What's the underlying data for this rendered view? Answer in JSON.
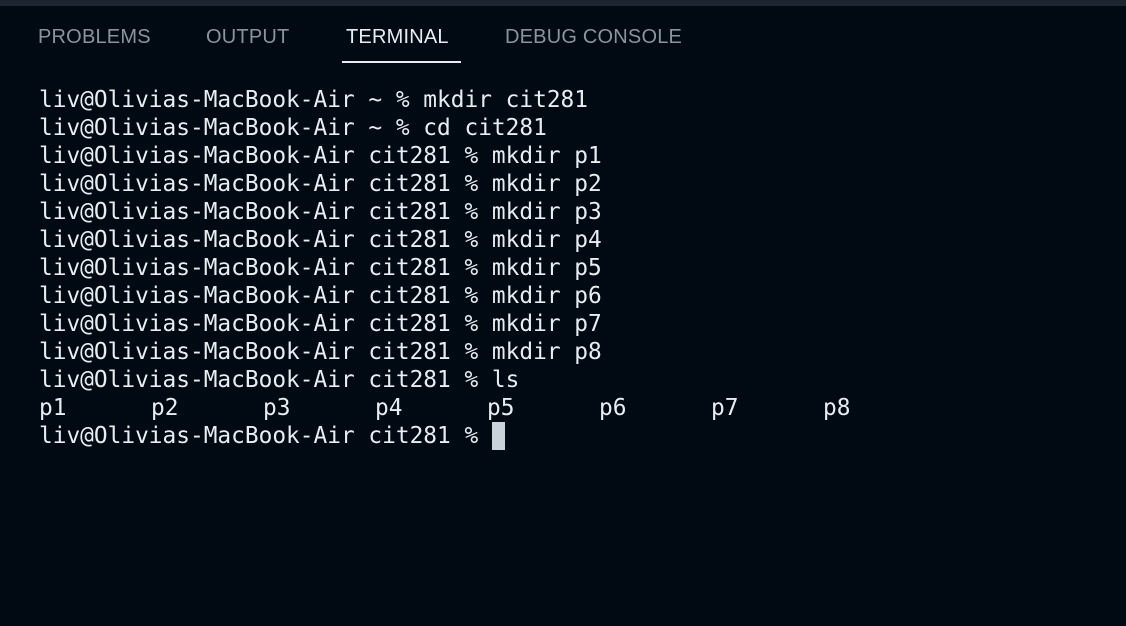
{
  "tabs": [
    {
      "label": "PROBLEMS",
      "active": false
    },
    {
      "label": "OUTPUT",
      "active": false
    },
    {
      "label": "TERMINAL",
      "active": true
    },
    {
      "label": "DEBUG CONSOLE",
      "active": false
    }
  ],
  "terminal": {
    "lines": [
      "liv@Olivias-MacBook-Air ~ % mkdir cit281",
      "liv@Olivias-MacBook-Air ~ % cd cit281",
      "liv@Olivias-MacBook-Air cit281 % mkdir p1",
      "liv@Olivias-MacBook-Air cit281 % mkdir p2",
      "liv@Olivias-MacBook-Air cit281 % mkdir p3",
      "liv@Olivias-MacBook-Air cit281 % mkdir p4",
      "liv@Olivias-MacBook-Air cit281 % mkdir p5",
      "liv@Olivias-MacBook-Air cit281 % mkdir p6",
      "liv@Olivias-MacBook-Air cit281 % mkdir p7",
      "liv@Olivias-MacBook-Air cit281 % mkdir p8",
      "liv@Olivias-MacBook-Air cit281 % ls"
    ],
    "ls_output": [
      "p1",
      "p2",
      "p3",
      "p4",
      "p5",
      "p6",
      "p7",
      "p8"
    ],
    "prompt": "liv@Olivias-MacBook-Air cit281 % "
  },
  "colors": {
    "background": "#010a12",
    "text": "#e6edf3",
    "inactive_tab": "#8b949e",
    "cursor": "#c9d1d9"
  }
}
